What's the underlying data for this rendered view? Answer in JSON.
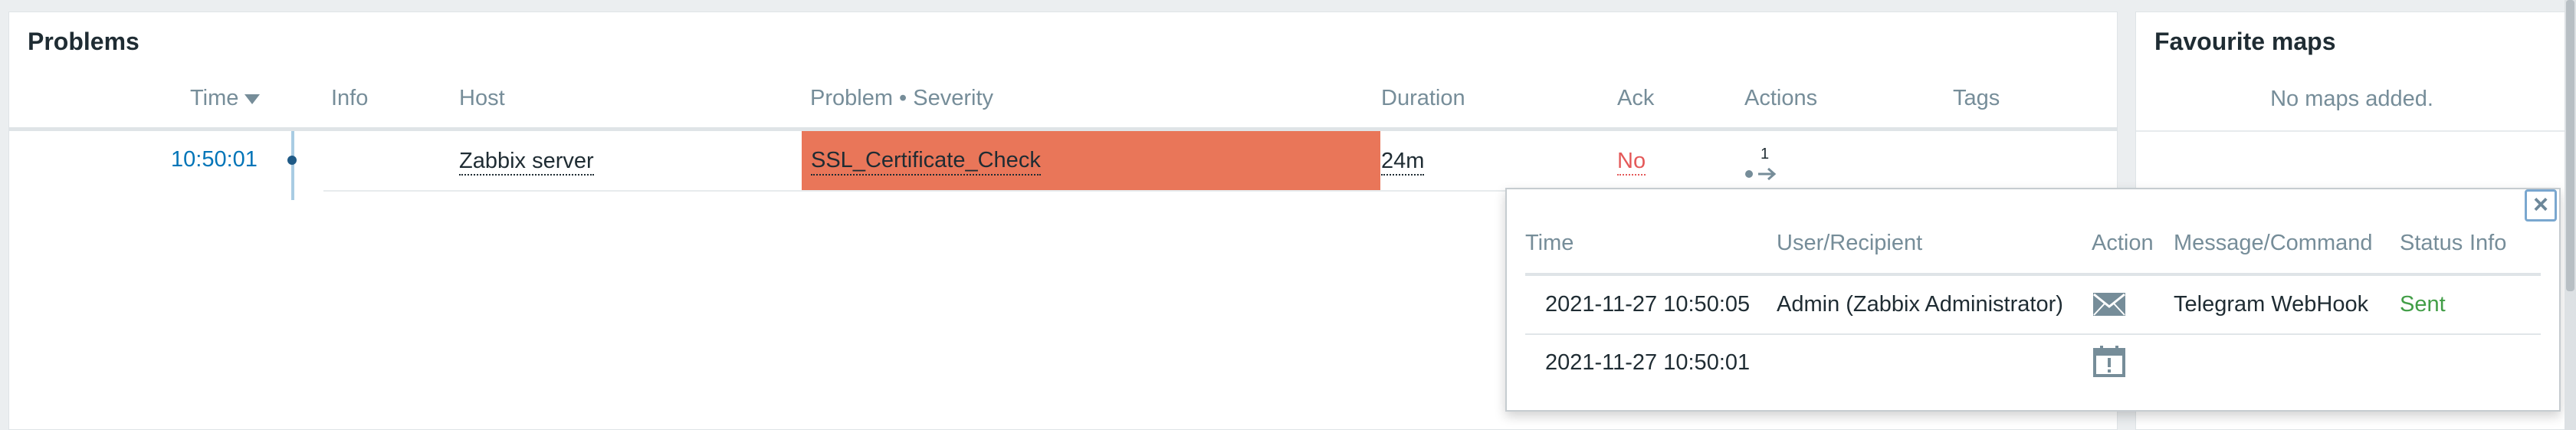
{
  "problems": {
    "title": "Problems",
    "headers": {
      "time": "Time",
      "info": "Info",
      "host": "Host",
      "problem": "Problem • Severity",
      "duration": "Duration",
      "ack": "Ack",
      "actions": "Actions",
      "tags": "Tags"
    },
    "row": {
      "time": "10:50:01",
      "host": "Zabbix server",
      "problem": "SSL_Certificate_Check",
      "duration": "24m",
      "ack": "No",
      "actions_count": "1"
    },
    "colors": {
      "severity": "#e97659",
      "ack_no": "#e45959",
      "time_link": "#0275b8"
    }
  },
  "maps": {
    "title": "Favourite maps",
    "empty_text": "No maps added."
  },
  "actions_popup": {
    "headers": {
      "time": "Time",
      "user": "User/Recipient",
      "action": "Action",
      "message": "Message/Command",
      "status": "Status",
      "info": "Info"
    },
    "rows": [
      {
        "time": "2021-11-27 10:50:05",
        "user": "Admin (Zabbix Administrator)",
        "action_icon": "envelope-icon",
        "message": "Telegram WebHook",
        "status": "Sent"
      },
      {
        "time": "2021-11-27 10:50:01",
        "user": "",
        "action_icon": "calendar-alert-icon",
        "message": "",
        "status": ""
      }
    ],
    "colors": {
      "sent": "#429e47"
    }
  }
}
